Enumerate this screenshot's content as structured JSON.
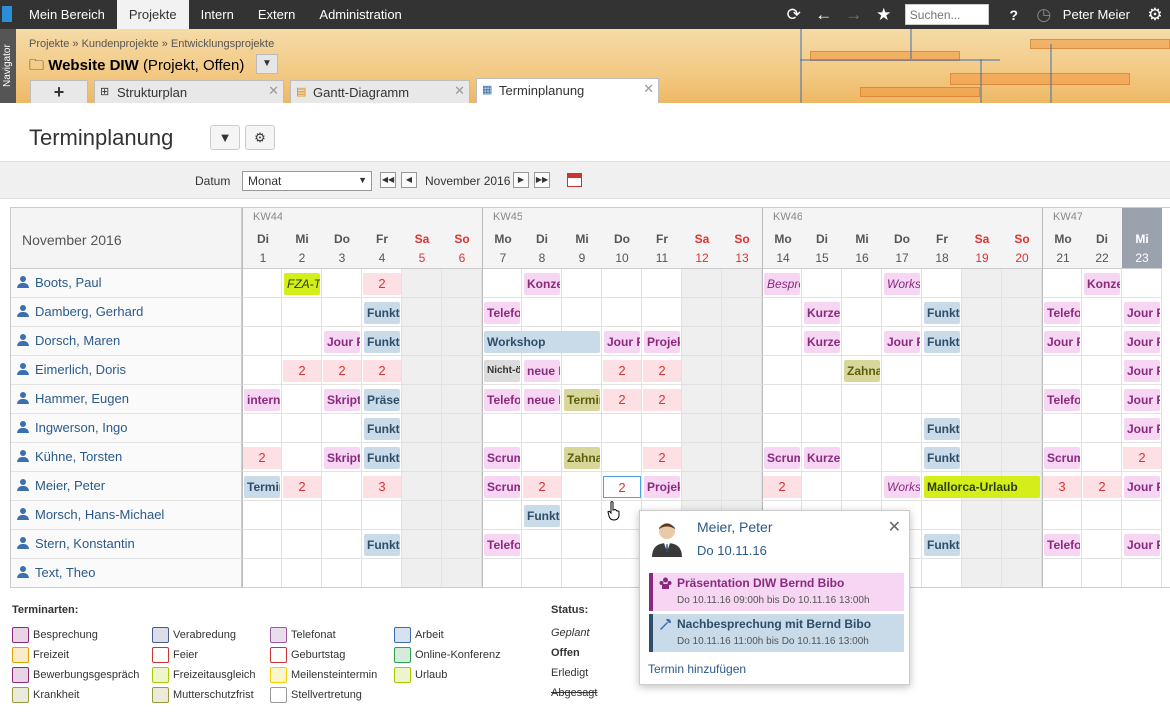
{
  "topnav": {
    "items": [
      "Mein Bereich",
      "Projekte",
      "Intern",
      "Extern",
      "Administration"
    ],
    "active_index": 1,
    "search_placeholder": "Suchen...",
    "user": "Peter Meier",
    "help": "?"
  },
  "navigator_label": "Navigator",
  "breadcrumb": "Projekte  »  Kundenprojekte  »  Entwicklungsprojekte",
  "project": {
    "name": "Website DIW",
    "status": "(Projekt, Offen)"
  },
  "tabs": [
    {
      "label": "Strukturplan"
    },
    {
      "label": "Gantt-Diagramm"
    },
    {
      "label": "Terminplanung"
    }
  ],
  "page_title": "Terminplanung",
  "toolbar": {
    "date_label": "Datum",
    "period": "Monat",
    "month": "November 2016"
  },
  "calendar": {
    "month_title": "November 2016",
    "weeks": [
      "KW44",
      "KW45",
      "KW46",
      "KW47"
    ],
    "days": [
      [
        "Di",
        "1"
      ],
      [
        "Mi",
        "2"
      ],
      [
        "Do",
        "3"
      ],
      [
        "Fr",
        "4"
      ],
      [
        "Sa",
        "5"
      ],
      [
        "So",
        "6"
      ],
      [
        "Mo",
        "7"
      ],
      [
        "Di",
        "8"
      ],
      [
        "Mi",
        "9"
      ],
      [
        "Do",
        "10"
      ],
      [
        "Fr",
        "11"
      ],
      [
        "Sa",
        "12"
      ],
      [
        "So",
        "13"
      ],
      [
        "Mo",
        "14"
      ],
      [
        "Di",
        "15"
      ],
      [
        "Mi",
        "16"
      ],
      [
        "Do",
        "17"
      ],
      [
        "Fr",
        "18"
      ],
      [
        "Sa",
        "19"
      ],
      [
        "So",
        "20"
      ],
      [
        "Mo",
        "21"
      ],
      [
        "Di",
        "22"
      ],
      [
        "Mi",
        "23"
      ]
    ],
    "people": [
      "Boots, Paul",
      "Damberg, Gerhard",
      "Dorsch, Maren",
      "Eimerlich, Doris",
      "Hammer, Eugen",
      "Ingwerson, Ingo",
      "Kühne, Torsten",
      "Meier, Peter",
      "Morsch, Hans-Michael",
      "Stern, Konstantin",
      "Text, Theo"
    ],
    "events": [
      [
        [
          1,
          1,
          "FZA-Te",
          "yg it"
        ],
        [
          3,
          1,
          "2",
          "cnt"
        ],
        [
          7,
          1,
          "Konzep",
          "pink"
        ],
        [
          13,
          1,
          "Besprec",
          "pl"
        ],
        [
          16,
          1,
          "Worksh",
          "pl"
        ],
        [
          21,
          1,
          "Konzep",
          "pink"
        ]
      ],
      [
        [
          3,
          1,
          "Funktio",
          "blue"
        ],
        [
          6,
          1,
          "Telefon",
          "pink"
        ],
        [
          14,
          1,
          "Kurzein",
          "pink"
        ],
        [
          17,
          1,
          "Funktio",
          "blue"
        ],
        [
          20,
          1,
          "Telefon",
          "pink"
        ],
        [
          22,
          1,
          "Jour Fi",
          "pink"
        ]
      ],
      [
        [
          2,
          1,
          "Jour Fi",
          "pink"
        ],
        [
          3,
          1,
          "Funktio",
          "blue"
        ],
        [
          6,
          3,
          "Workshop",
          "blue"
        ],
        [
          9,
          1,
          "Jour Fi",
          "pink"
        ],
        [
          10,
          1,
          "Projekt",
          "pink"
        ],
        [
          14,
          1,
          "Kurzein",
          "pink"
        ],
        [
          16,
          1,
          "Jour Fi",
          "pink"
        ],
        [
          17,
          1,
          "Funktio",
          "blue"
        ],
        [
          20,
          1,
          "Jour Fi",
          "pink"
        ],
        [
          22,
          1,
          "Jour Fi",
          "pink"
        ]
      ],
      [
        [
          1,
          1,
          "2",
          "cnt"
        ],
        [
          2,
          1,
          "2",
          "cnt"
        ],
        [
          3,
          1,
          "2",
          "cnt"
        ],
        [
          6,
          1,
          "Nicht-ö",
          "gray"
        ],
        [
          7,
          1,
          "neue P",
          "pink"
        ],
        [
          9,
          1,
          "2",
          "cnt"
        ],
        [
          10,
          1,
          "2",
          "cnt"
        ],
        [
          15,
          1,
          "Zahnar",
          "olive"
        ],
        [
          22,
          1,
          "Jour Fi",
          "pink"
        ]
      ],
      [
        [
          0,
          1,
          "interne",
          "pink"
        ],
        [
          2,
          1,
          "Skripte",
          "pink"
        ],
        [
          3,
          1,
          "Präsen",
          "blue"
        ],
        [
          6,
          1,
          "Telefon",
          "pink"
        ],
        [
          7,
          1,
          "neue P",
          "pink"
        ],
        [
          8,
          1,
          "Termin",
          "olive"
        ],
        [
          9,
          1,
          "2",
          "cnt"
        ],
        [
          10,
          1,
          "2",
          "cnt"
        ],
        [
          20,
          1,
          "Telefon",
          "pink"
        ],
        [
          22,
          1,
          "Jour Fi",
          "pink"
        ]
      ],
      [
        [
          3,
          1,
          "Funktio",
          "blue"
        ],
        [
          17,
          1,
          "Funktio",
          "blue"
        ],
        [
          22,
          1,
          "Jour Fi",
          "pink"
        ]
      ],
      [
        [
          0,
          1,
          "2",
          "cnt"
        ],
        [
          2,
          1,
          "Skripte",
          "pink"
        ],
        [
          3,
          1,
          "Funktio",
          "blue"
        ],
        [
          6,
          1,
          "Scrum",
          "pink"
        ],
        [
          8,
          1,
          "Zahnar",
          "olive"
        ],
        [
          10,
          1,
          "2",
          "cnt"
        ],
        [
          13,
          1,
          "Scrum",
          "pink"
        ],
        [
          14,
          1,
          "Kurzein",
          "pink"
        ],
        [
          17,
          1,
          "Funktio",
          "blue"
        ],
        [
          20,
          1,
          "Scrum",
          "pink"
        ],
        [
          22,
          1,
          "2",
          "cnt"
        ]
      ],
      [
        [
          0,
          1,
          "Termin",
          "blue"
        ],
        [
          1,
          1,
          "2",
          "cnt"
        ],
        [
          3,
          1,
          "3",
          "cnt"
        ],
        [
          6,
          1,
          "Scrum",
          "pink"
        ],
        [
          7,
          1,
          "2",
          "cnt"
        ],
        [
          9,
          1,
          "2",
          "sel"
        ],
        [
          10,
          1,
          "Projekt",
          "pink"
        ],
        [
          13,
          1,
          "2",
          "cnt"
        ],
        [
          16,
          1,
          "Worksh",
          "pl"
        ],
        [
          17,
          3,
          "Mallorca-Urlaub",
          "yg"
        ],
        [
          20,
          1,
          "3",
          "cnt"
        ],
        [
          21,
          1,
          "2",
          "cnt"
        ],
        [
          22,
          1,
          "Jour Fi",
          "pink"
        ]
      ],
      [
        [
          7,
          1,
          "Funktio",
          "blue"
        ]
      ],
      [
        [
          3,
          1,
          "Funktio",
          "blue"
        ],
        [
          6,
          1,
          "Telefon",
          "pink"
        ],
        [
          17,
          1,
          "Funktio",
          "blue"
        ],
        [
          20,
          1,
          "Telefon",
          "pink"
        ],
        [
          22,
          1,
          "Jour Fi",
          "pink"
        ]
      ],
      []
    ]
  },
  "legend": {
    "title": "Terminarten:",
    "items": [
      {
        "label": "Besprechung",
        "color": "#8a2a7e"
      },
      {
        "label": "Verabredung",
        "color": "#4a5a8a"
      },
      {
        "label": "Telefonat",
        "color": "#9a5aa0"
      },
      {
        "label": "Arbeit",
        "color": "#3a6fb0"
      },
      {
        "label": "Freizeit",
        "color": "#e0a000"
      },
      {
        "label": "Feier",
        "color": "#c33"
      },
      {
        "label": "Geburtstag",
        "color": "#c33"
      },
      {
        "label": "Online-Konferenz",
        "color": "#2aa050"
      },
      {
        "label": "Bewerbungsgespräch",
        "color": "#8a2a7e"
      },
      {
        "label": "Freizeitausgleich",
        "color": "#aac800"
      },
      {
        "label": "Meilensteintermin",
        "color": "#f0d000"
      },
      {
        "label": "Urlaub",
        "color": "#aac800"
      },
      {
        "label": "Krankheit",
        "color": "#9a9a40"
      },
      {
        "label": "Mutterschutzfrist",
        "color": "#9a9a40"
      },
      {
        "label": "Stellvertretung",
        "color": "#999"
      }
    ],
    "status_title": "Status:",
    "status": [
      "Geplant",
      "Offen",
      "Erledigt",
      "Abgesagt"
    ]
  },
  "popup": {
    "name": "Meier, Peter",
    "date": "Do 10.11.16",
    "events": [
      {
        "title": "Präsentation DIW Bernd Bibo",
        "time": "Do 10.11.16 09:00h  bis  Do 10.11.16 13:00h"
      },
      {
        "title": "Nachbesprechung mit Bernd Bibo",
        "time": "Do 10.11.16 11:00h  bis  Do 10.11.16 13:00h"
      }
    ],
    "add": "Termin hinzufügen"
  }
}
